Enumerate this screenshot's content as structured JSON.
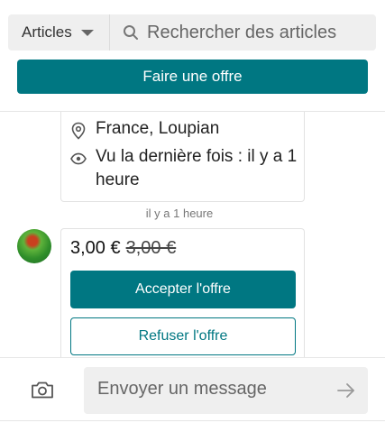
{
  "header": {
    "category_label": "Articles",
    "search_placeholder": "Rechercher des articles"
  },
  "offer_banner": {
    "button_label": "Faire une offre"
  },
  "item_info": {
    "location": "France, Loupian",
    "last_seen": "Vu la dernière fois : il y a 1 heure"
  },
  "conversation": {
    "timestamp": "il y a 1 heure",
    "offer": {
      "price_new": "3,00 €",
      "price_old": "3,00 €",
      "accept_label": "Accepter l'offre",
      "refuse_label": "Refuser l'offre"
    }
  },
  "composer": {
    "message_placeholder": "Envoyer un message"
  },
  "icons": {
    "search": "search-icon",
    "location": "location-pin-icon",
    "last_seen": "eye-icon",
    "camera": "camera-icon",
    "send": "arrow-right-icon",
    "category": "chevron-down-icon"
  },
  "colors": {
    "accent": "#007782",
    "input_bg": "#efefef",
    "border": "#e2e2e2"
  }
}
